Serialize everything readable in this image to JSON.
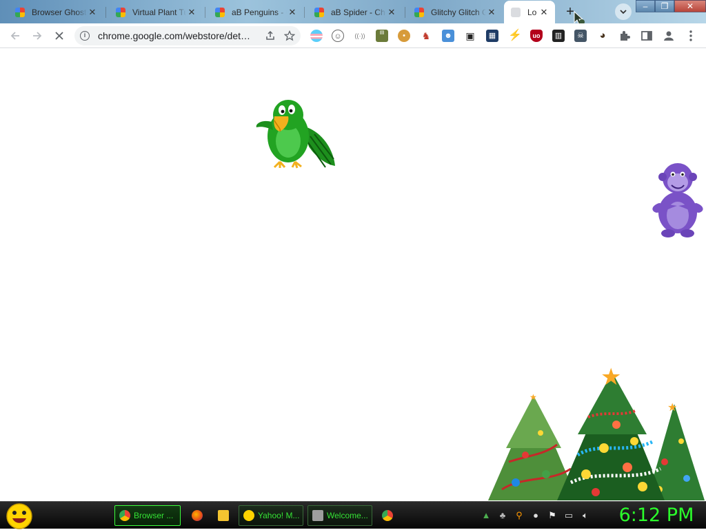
{
  "browser": {
    "tabs": [
      {
        "title": "Browser Ghost",
        "close": "✕"
      },
      {
        "title": "Virtual Plant Tu",
        "close": "✕"
      },
      {
        "title": "aB Penguins - C",
        "close": "✕"
      },
      {
        "title": "aB Spider - Chr",
        "close": "✕"
      },
      {
        "title": "Glitchy Glitch G",
        "close": "✕"
      },
      {
        "title": "Lo",
        "close": "✕"
      }
    ],
    "new_tab": "+",
    "url": "chrome.google.com/webstore/det…",
    "window_buttons": {
      "minimize": "‒",
      "maximize": "❐",
      "close": "✕"
    }
  },
  "icons": {
    "back": "arrow-left",
    "forward": "arrow-right",
    "stop": "x",
    "share": "share",
    "bookmark": "star",
    "extensions": "puzzle",
    "side_panel": "panel",
    "profile": "person",
    "menu": "kebab"
  },
  "extensions": [
    {
      "name": "pride-flag",
      "color": "#8fc9f0"
    },
    {
      "name": "face-outline",
      "color": "#666666"
    },
    {
      "name": "dots-ext",
      "color": "#888888"
    },
    {
      "name": "hidden-word",
      "color": "#5a7a3a"
    },
    {
      "name": "cookie",
      "color": "#d79b3a"
    },
    {
      "name": "red-figure",
      "color": "#c0392b"
    },
    {
      "name": "character-card",
      "color": "#4a90d9"
    },
    {
      "name": "car-face",
      "color": "#333333"
    },
    {
      "name": "dark-scene",
      "color": "#1f3c66"
    },
    {
      "name": "lightning",
      "color": "#f5c400"
    },
    {
      "name": "ublock",
      "color": "#b3001b"
    },
    {
      "name": "grid-ext",
      "color": "#222222"
    },
    {
      "name": "ghost-card",
      "color": "#445566"
    },
    {
      "name": "ninja",
      "color": "#4b3621"
    }
  ],
  "page": {
    "sprites": [
      "green-parrot",
      "purple-gorilla",
      "christmas-trees"
    ]
  },
  "taskbar": {
    "items": [
      {
        "label": "Browser ...",
        "state": "active"
      },
      {
        "label": "",
        "state": "plain"
      },
      {
        "label": "",
        "state": "plain"
      },
      {
        "label": "Yahoo! M...",
        "state": "boxed"
      },
      {
        "label": "Welcome...",
        "state": "boxed"
      },
      {
        "label": "",
        "state": "plain"
      }
    ],
    "clock": "6:12 PM",
    "accent": "#2bff2b"
  }
}
